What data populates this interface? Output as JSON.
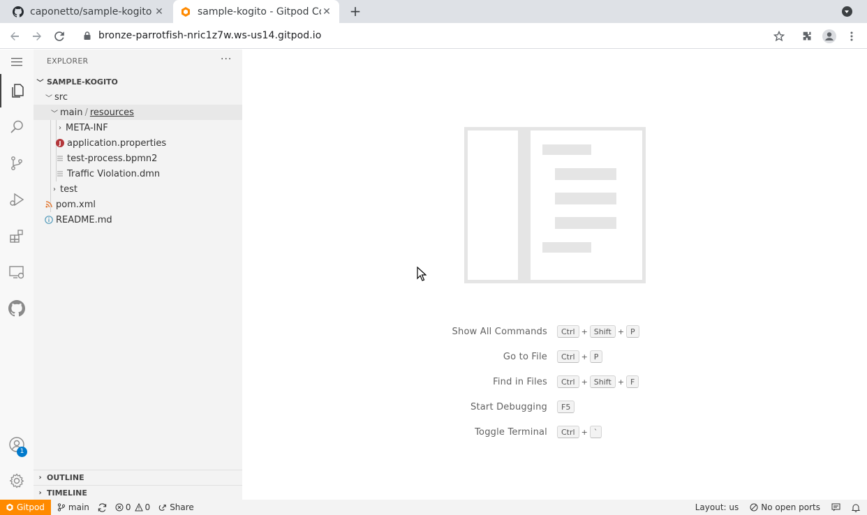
{
  "browser": {
    "tabs": [
      {
        "title": "caponetto/sample-kogito",
        "active": false
      },
      {
        "title": "sample-kogito - Gitpod Co",
        "active": true
      }
    ],
    "url": "bronze-parrotfish-nric1z7w.ws-us14.gitpod.io"
  },
  "explorer": {
    "title": "EXPLORER",
    "more": "···",
    "root": "SAMPLE-KOGITO",
    "items": {
      "src": "src",
      "main": "main",
      "path_sep": "/",
      "resources": "resources",
      "meta_inf": "META-INF",
      "app_props": "application.properties",
      "bpmn": "test-process.bpmn2",
      "dmn": "Traffic Violation.dmn",
      "test": "test",
      "pom": "pom.xml",
      "readme": "README.md"
    },
    "outline": "OUTLINE",
    "timeline": "TIMELINE"
  },
  "editor": {
    "commands": [
      {
        "label": "Show All Commands",
        "keys": [
          "Ctrl",
          "Shift",
          "P"
        ]
      },
      {
        "label": "Go to File",
        "keys": [
          "Ctrl",
          "P"
        ]
      },
      {
        "label": "Find in Files",
        "keys": [
          "Ctrl",
          "Shift",
          "F"
        ]
      },
      {
        "label": "Start Debugging",
        "keys": [
          "F5"
        ]
      },
      {
        "label": "Toggle Terminal",
        "keys": [
          "Ctrl",
          "`"
        ]
      }
    ]
  },
  "activity": {
    "accounts_badge": "1"
  },
  "status": {
    "remote": "Gitpod",
    "branch": "main",
    "errors": "0",
    "warnings": "0",
    "share": "Share",
    "layout": "Layout: us",
    "ports": "No open ports"
  },
  "colors": {
    "accent": "#ff8a00",
    "badge": "#007acc"
  }
}
